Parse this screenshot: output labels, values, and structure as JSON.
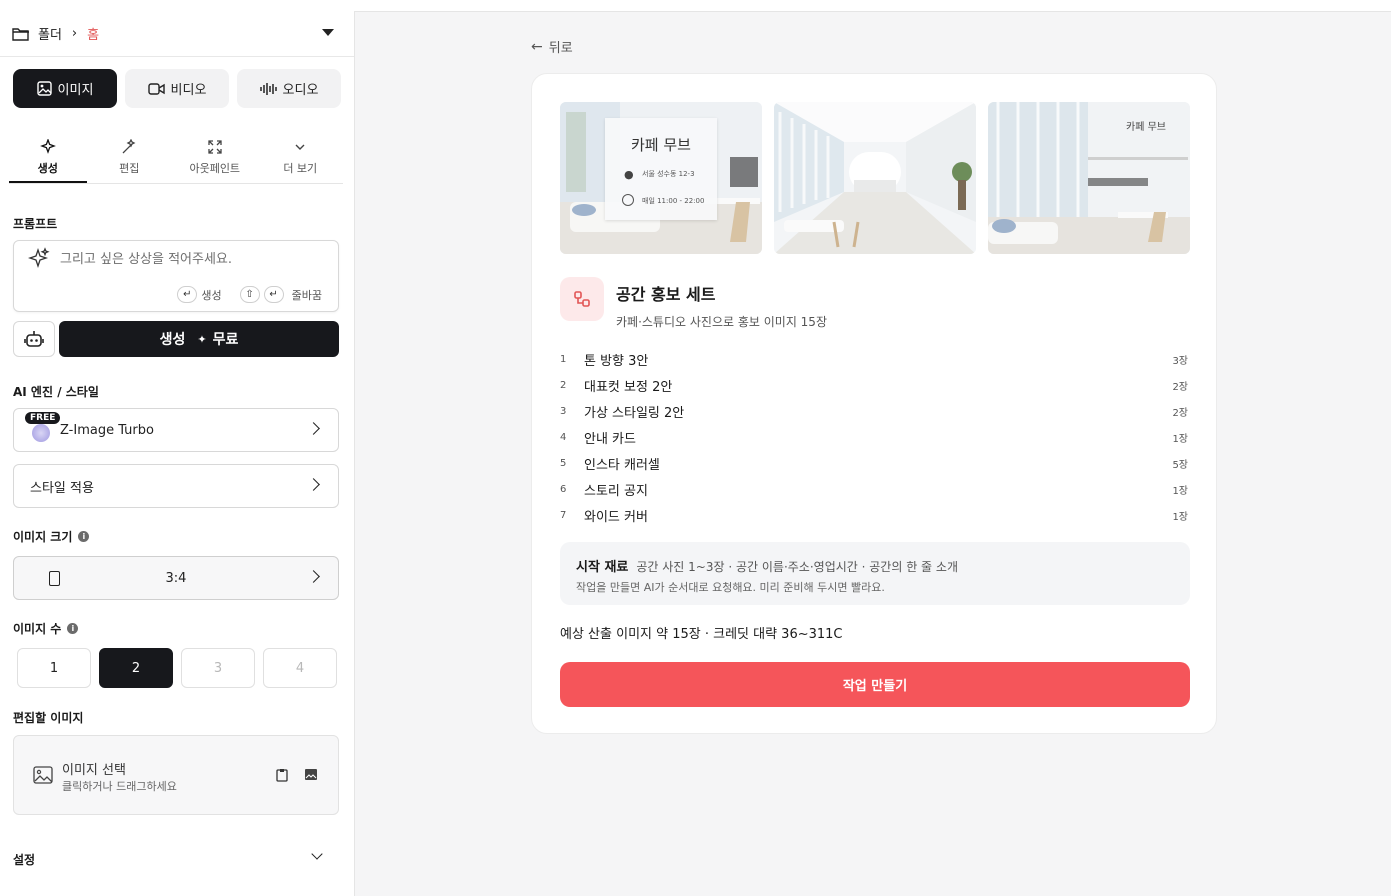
{
  "breadcrumb": {
    "folder": "폴더",
    "home": "홈"
  },
  "media_tabs": [
    {
      "label": "이미지",
      "icon": "image-icon",
      "active": true
    },
    {
      "label": "비디오",
      "icon": "video-icon",
      "active": false
    },
    {
      "label": "오디오",
      "icon": "audio-wave-icon",
      "active": false
    }
  ],
  "sub_tabs": [
    {
      "label": "생성",
      "active": true
    },
    {
      "label": "편집",
      "active": false
    },
    {
      "label": "아웃페인트",
      "active": false
    },
    {
      "label": "더 보기",
      "active": false
    }
  ],
  "prompt": {
    "label": "프롬프트",
    "placeholder": "그리고 싶은 상상을 적어주세요.",
    "hint_generate": "생성",
    "hint_newline": "줄바꿈"
  },
  "generate": {
    "label": "생성",
    "price": "무료"
  },
  "engine": {
    "label": "AI 엔진 / 스타일",
    "badge": "FREE",
    "model": "Z-Image Turbo",
    "style": "스타일 적용"
  },
  "size": {
    "label": "이미지 크기",
    "value": "3:4"
  },
  "count": {
    "label": "이미지 수",
    "options": [
      "1",
      "2",
      "3",
      "4"
    ],
    "selected": "2"
  },
  "edit_image": {
    "label": "편집할 이미지",
    "title": "이미지 선택",
    "subtitle": "클릭하거나 드래그하세요"
  },
  "settings": {
    "label": "설정"
  },
  "main": {
    "back": "뒤로",
    "photo1": {
      "title": "카페 무브",
      "address": "서울 성수동 12-3",
      "hours": "매일 11:00 - 22:00"
    },
    "photo3": {
      "title": "카페 무브"
    },
    "set_title": "공간 홍보 세트",
    "set_subtitle": "카페·스튜디오 사진으로 홍보 이미지 15장",
    "items": [
      {
        "n": "1",
        "label": "톤 방향 3안",
        "count": "3장"
      },
      {
        "n": "2",
        "label": "대표컷 보정 2안",
        "count": "2장"
      },
      {
        "n": "3",
        "label": "가상 스타일링 2안",
        "count": "2장"
      },
      {
        "n": "4",
        "label": "안내 카드",
        "count": "1장"
      },
      {
        "n": "5",
        "label": "인스타 캐러셀",
        "count": "5장"
      },
      {
        "n": "6",
        "label": "스토리 공지",
        "count": "1장"
      },
      {
        "n": "7",
        "label": "와이드 커버",
        "count": "1장"
      }
    ],
    "materials_label": "시작 재료",
    "materials": "공간 사진 1~3장 · 공간 이름·주소·영업시간 · 공간의 한 줄 소개",
    "materials_note": "작업을 만들면 AI가 순서대로 요청해요. 미리 준비해 두시면 빨라요.",
    "estimate": "예상 산출 이미지 약 15장 · 크레딧 대략 36~311C",
    "create_button": "작업 만들기"
  },
  "colors": {
    "accent": "#f5555a",
    "dark": "#17181c",
    "home_link": "#e25555"
  }
}
